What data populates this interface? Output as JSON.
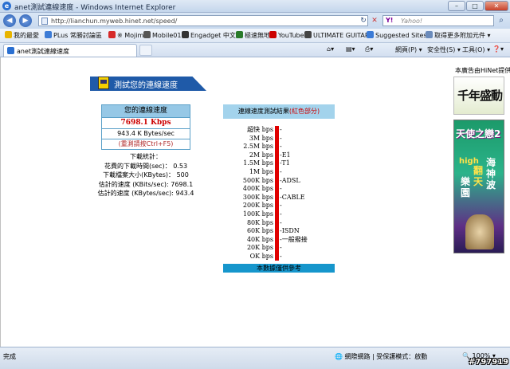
{
  "window": {
    "title": "anet測試連線速度 - Windows Internet Explorer",
    "minimize": "–",
    "maximize": "□",
    "close": "✕"
  },
  "address": {
    "back": "◀",
    "forward": "▶",
    "url": "http://lianchun.myweb.hinet.net/speed/",
    "refresh": "↻",
    "stop": "✕",
    "search_brand": "Y!",
    "search_placeholder": "Yahoo!",
    "search_go": "⌕"
  },
  "favorites": [
    {
      "label": "我的最愛",
      "color": "#e8b400"
    },
    {
      "label": "PLus 常勝討論區",
      "color": "#3c7bd6"
    },
    {
      "label": "※ Mojim",
      "color": "#d62a2a"
    },
    {
      "label": "Mobile01",
      "color": "#555555"
    },
    {
      "label": "Engadget 中文版",
      "color": "#333333"
    },
    {
      "label": "極速無地",
      "color": "#2a7a2a"
    },
    {
      "label": "YouTube",
      "color": "#cc0000"
    },
    {
      "label": "ULTIMATE GUITAR",
      "color": "#444444"
    },
    {
      "label": "Suggested Sites ▾",
      "color": "#3c7bd6"
    },
    {
      "label": "取得更多附加元件 ▾",
      "color": "#6b8bbb"
    }
  ],
  "tab": {
    "label": "anet測試連線速度"
  },
  "toolbar_right": {
    "page": "網頁(P) ▾",
    "safety": "安全性(S) ▾",
    "tools": "工具(O) ▾",
    "help": "❓▾"
  },
  "page": {
    "banner": "測試您的連線速度",
    "speed_header": "您的連線速度",
    "speed_value": "7698.1 Kbps",
    "bytes_value": "943.4 K Bytes/sec",
    "retest": "(重測請按Ctrl+F5)",
    "stats_title": "下載統計：",
    "stats": [
      {
        "label": "花費的下載時間(sec)：",
        "value": "0.53"
      },
      {
        "label": "下載檔案大小(KBytes)：",
        "value": "500"
      },
      {
        "label": "估計的速度 (KBits/sec):",
        "value": "7698.1"
      },
      {
        "label": "估計的速度 (KBytes/sec):",
        "value": "943.4"
      }
    ],
    "result_header_prefix": "連線速度測試結果",
    "result_header_red": "(紅色部分)",
    "scale_labels": [
      "超快 bps",
      "3M bps",
      "2.5M bps",
      "2M bps",
      "1.5M bps",
      "1M bps",
      "500K bps",
      "400K bps",
      "300K bps",
      "200K bps",
      "100K bps",
      "80K bps",
      "60K bps",
      "40K bps",
      "20K bps",
      "OK bps"
    ],
    "scale_annotations": [
      "-",
      "-",
      "-",
      "-E1",
      "-T1",
      "-",
      "-ADSL",
      "-",
      "-CABLE",
      "-",
      "-",
      "-",
      "-ISDN",
      "-一般撥接",
      "-",
      "-"
    ],
    "result_footer": "本數據僅供參考",
    "meter_fraction": 1.0,
    "sponsor": "本廣告由HiNet提供",
    "ad1_text": "千年盛動",
    "ad2_title": "天使之戀2",
    "ad2_brand": "high",
    "ad2_v1": "海神波",
    "ad2_v2": "翻天",
    "ad2_v3": "樂園"
  },
  "status": {
    "text": "完成",
    "zone": "網際網路 | 受保護模式：啟動",
    "zoom": "100%"
  },
  "watermark": "#797919"
}
